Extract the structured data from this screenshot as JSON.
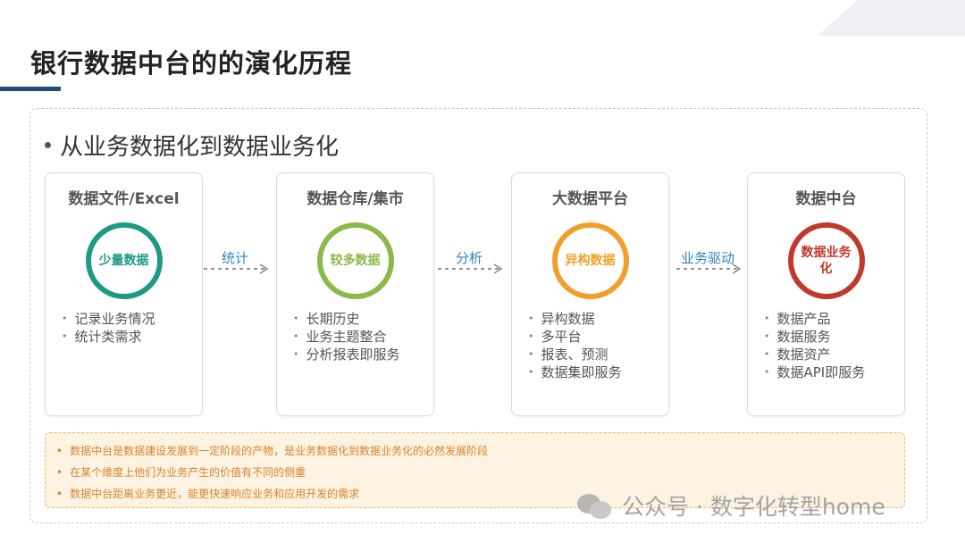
{
  "page": {
    "title": "银行数据中台的的演化历程"
  },
  "main": {
    "subtitle": "从业务数据化到数据业务化"
  },
  "stages": [
    {
      "title": "数据文件/Excel",
      "circle_label": "少量数据",
      "color": "#1e9a84",
      "items": [
        "记录业务情况",
        "统计类需求"
      ]
    },
    {
      "title": "数据仓库/集市",
      "circle_label": "较多数据",
      "color": "#8cb94a",
      "items": [
        "长期历史",
        "业务主题整合",
        "分析报表即服务"
      ]
    },
    {
      "title": "大数据平台",
      "circle_label": "异构数据",
      "color": "#f0a02a",
      "items": [
        "异构数据",
        "多平台",
        "报表、预测",
        "数据集即服务"
      ]
    },
    {
      "title": "数据中台",
      "circle_label": "数据业务化",
      "color": "#c0392b",
      "items": [
        "数据产品",
        "数据服务",
        "数据资产",
        "数据API即服务"
      ]
    }
  ],
  "arrows": [
    "统计",
    "分析",
    "业务驱动"
  ],
  "notes": [
    "数据中台是数据建设发展到一定阶段的产物，是业务数据化到数据业务化的必然发展阶段",
    "在某个维度上他们为业务产生的价值有不同的侧重",
    "数据中台距离业务更近，能更快速响应业务和应用开发的需求"
  ],
  "watermark": {
    "text": "公众号 · 数字化转型home",
    "icon": "wechat-icon"
  },
  "colors": {
    "accent": "#1f4e79",
    "arrow_label": "#2e86c1",
    "note_text": "#d9822b",
    "note_bg": "#fdf3e3"
  }
}
